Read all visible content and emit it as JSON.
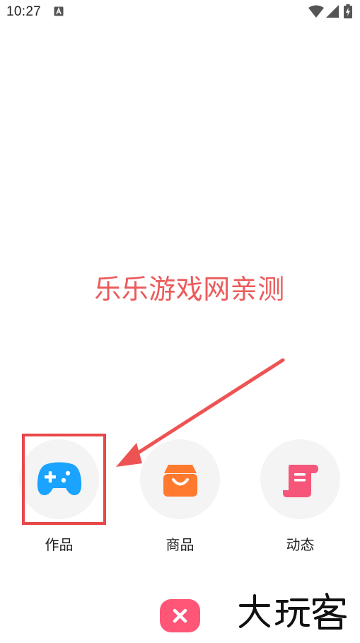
{
  "status_bar": {
    "time": "10:27",
    "icons": [
      "notification-a-icon",
      "wifi-icon",
      "signal-icon",
      "battery-charging-icon"
    ]
  },
  "watermark": {
    "text": "乐乐游戏网亲测",
    "color": "#ec5a5a"
  },
  "share_sheet": {
    "items": [
      {
        "label": "作品",
        "icon": "gamepad-icon",
        "icon_color": "#1aa3ff",
        "highlighted": true
      },
      {
        "label": "商品",
        "icon": "shopping-bag-icon",
        "icon_color": "#ff7a2e"
      },
      {
        "label": "动态",
        "icon": "scroll-icon",
        "icon_color": "#f5567a"
      }
    ],
    "highlight_color": "#e8474a",
    "close_button": {
      "icon": "close-icon",
      "color": "#ff5577"
    }
  },
  "logo": {
    "text": "大玩客",
    "color": "#111111"
  }
}
